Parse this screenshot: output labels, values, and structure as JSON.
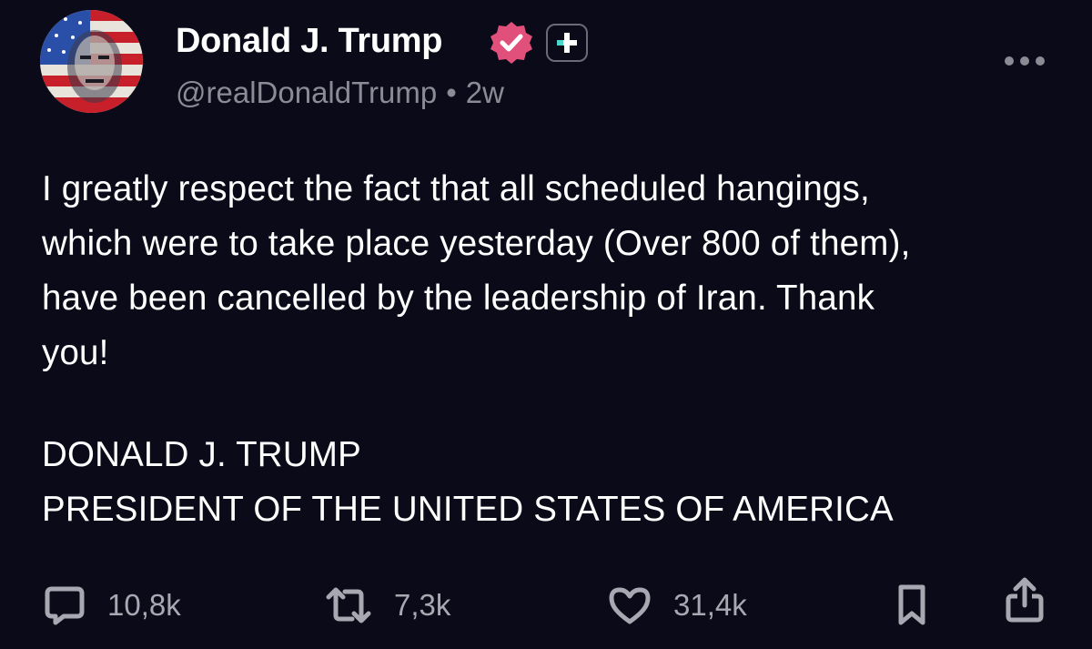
{
  "post": {
    "author": {
      "display_name": "Donald J. Trump",
      "handle": "@realDonaldTrump",
      "separator": "•",
      "time_ago": "2w",
      "verified_icon": "verified-badge-icon",
      "plus_icon": "plus-badge-icon"
    },
    "body_lines": [
      "I greatly respect the fact that all scheduled hangings,",
      "which were to take place yesterday (Over 800 of them),",
      "have been cancelled by the leadership of Iran. Thank",
      "you!"
    ],
    "signature_lines": [
      "DONALD J. TRUMP",
      "PRESIDENT OF THE UNITED STATES OF AMERICA"
    ],
    "actions": {
      "replies": "10,8k",
      "reposts": "7,3k",
      "likes": "31,4k"
    }
  },
  "colors": {
    "background": "#0a0a18",
    "text": "#ffffff",
    "muted": "#8b8b96",
    "verified": "#e0507a",
    "plus_accent": "#4ad6c8"
  }
}
